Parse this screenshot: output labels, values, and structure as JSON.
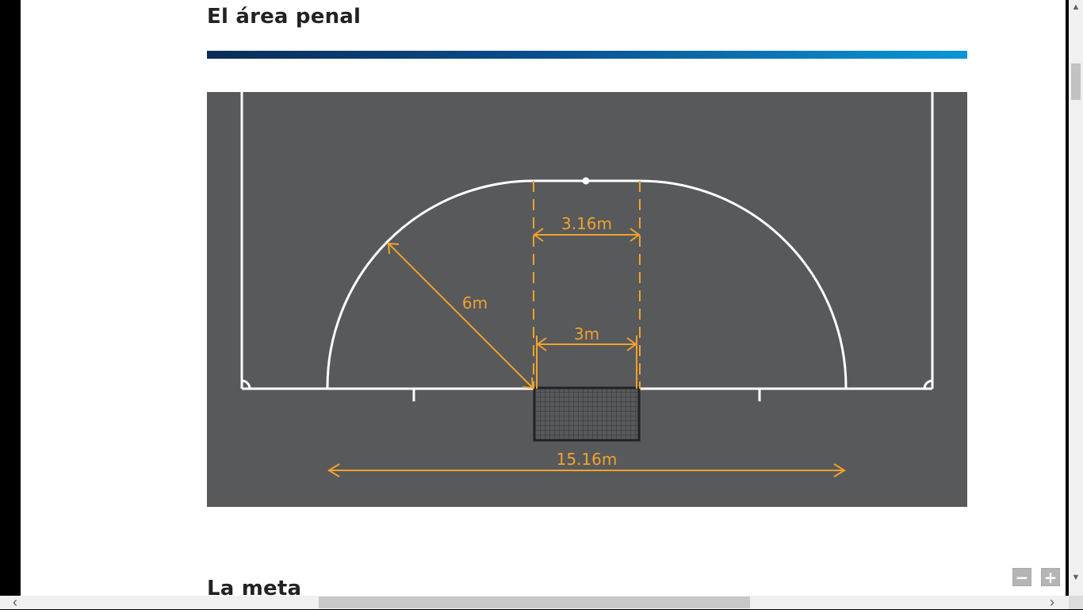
{
  "sections": {
    "penalty_area_title": "El área penal",
    "goal_title": "La meta"
  },
  "diagram": {
    "labels": {
      "radius": "6m",
      "top_width": "3.16m",
      "goal_width": "3m",
      "total_width": "15.16m"
    },
    "colors": {
      "court": "#58595b",
      "lines": "#ffffff",
      "dimensions": "#f0a22e",
      "goal": "#222222"
    }
  },
  "viewer": {
    "zoom_out_label": "−",
    "zoom_in_label": "+"
  },
  "colors": {
    "accent_dark": "#0b2c57",
    "accent_light": "#0a96d6"
  }
}
